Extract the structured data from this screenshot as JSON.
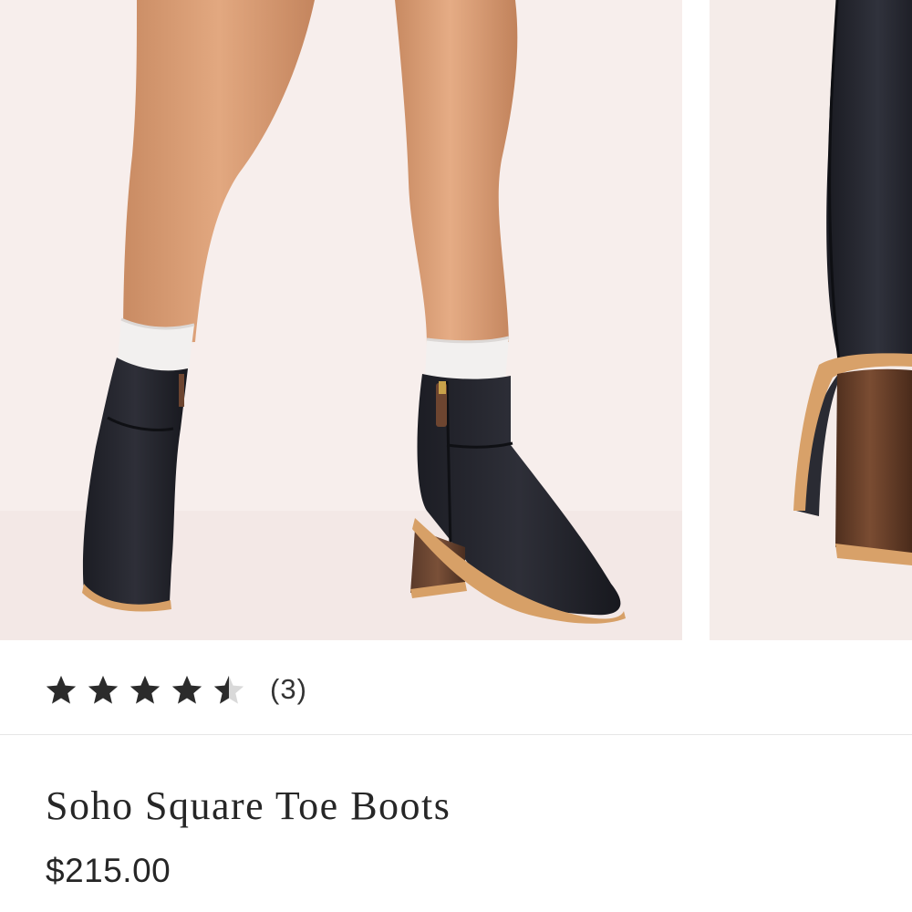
{
  "gallery": {
    "main_image_alt": "",
    "next_image_alt": ""
  },
  "rating": {
    "value_out_of_5": 4.5,
    "review_count_label": "(3)"
  },
  "product": {
    "title": "Soho Square Toe Boots",
    "price": "$215.00"
  },
  "colors": {
    "background": "#ffffff",
    "photo_backdrop": "#f7eeec",
    "text": "#262626",
    "star": "#2b2b2b",
    "star_empty": "#d9d9d9"
  },
  "icons": [
    "star-icon",
    "half-star-icon"
  ]
}
